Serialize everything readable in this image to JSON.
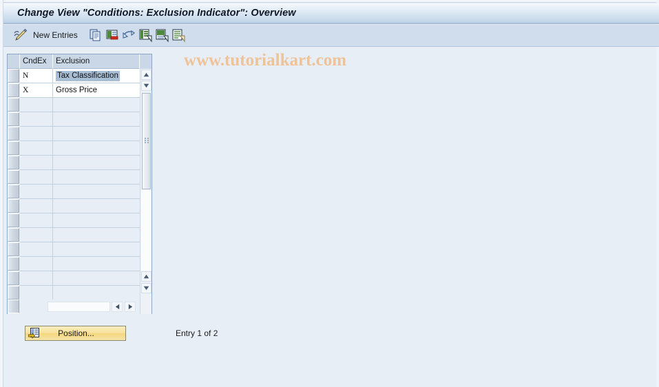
{
  "window": {
    "title": "Change View \"Conditions: Exclusion Indicator\": Overview",
    "background_color": "#e8eef6"
  },
  "toolbar": {
    "new_entries_label": "New Entries",
    "icons": [
      {
        "name": "pencil-display-change-icon",
        "title": "Display/Change"
      },
      {
        "name": "copy-as-icon",
        "title": "Copy As..."
      },
      {
        "name": "delete-icon",
        "title": "Delete"
      },
      {
        "name": "undo-icon",
        "title": "Undo Change"
      },
      {
        "name": "select-all-icon",
        "title": "Select All"
      },
      {
        "name": "select-block-icon",
        "title": "Select Block"
      },
      {
        "name": "details-icon",
        "title": "Details"
      }
    ]
  },
  "watermark": {
    "text": "www.tutorialkart.com",
    "color": "#eec39a"
  },
  "table": {
    "config_icon": "table-settings-icon",
    "columns": [
      {
        "key": "select",
        "label": ""
      },
      {
        "key": "cndex",
        "label": "CndEx"
      },
      {
        "key": "exclusion",
        "label": "Exclusion"
      }
    ],
    "rows": [
      {
        "cndex": "N",
        "exclusion": "Tax Classification",
        "selected": true
      },
      {
        "cndex": "X",
        "exclusion": "Gross Price",
        "selected": false
      }
    ],
    "empty_row_count": 14,
    "selection_highlight_color": "#a8bed4",
    "scrollbar": {
      "up_arrow": "scroll-up-icon",
      "down_arrow": "scroll-down-icon",
      "left_arrow": "scroll-left-icon",
      "right_arrow": "scroll-right-icon"
    }
  },
  "footer": {
    "position_button_label": "Position...",
    "position_button_icon": "position-goto-icon",
    "entry_status": "Entry 1 of 2"
  }
}
